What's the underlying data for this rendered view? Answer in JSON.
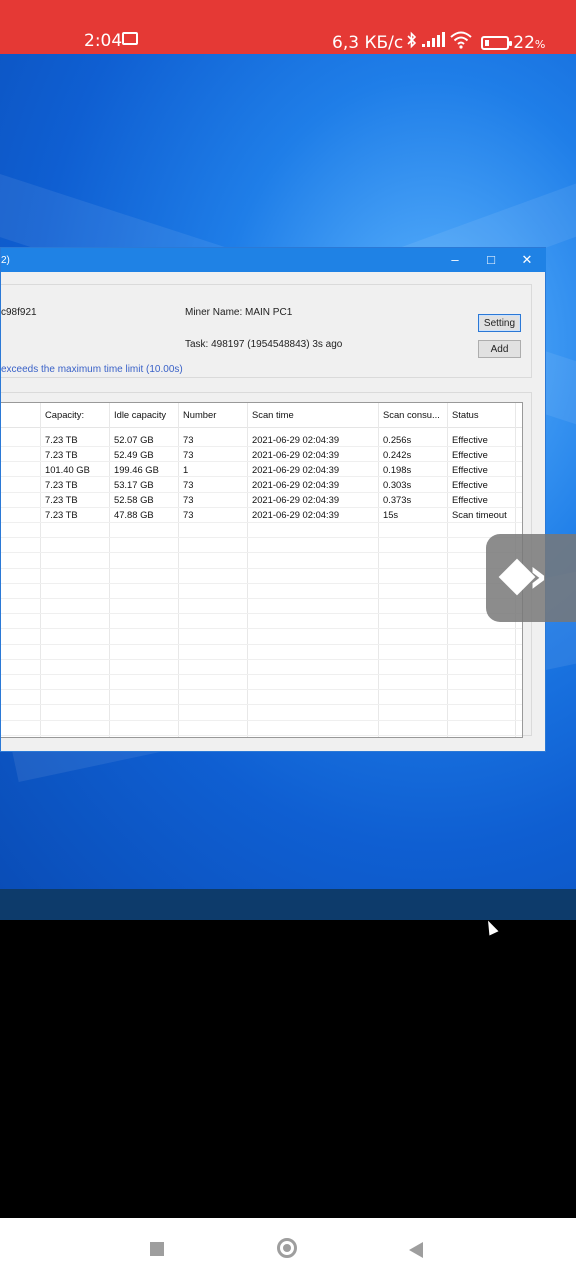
{
  "status_bar": {
    "time": "2:04",
    "speed": "6,3 КБ/с",
    "battery_percent": "22",
    "battery_unit": "%",
    "battery_level": 0.22,
    "background_color": "#e53935",
    "icons": [
      "screen-notification-icon",
      "bluetooth-icon",
      "signal-icon",
      "wifi-icon",
      "battery-icon"
    ]
  },
  "window": {
    "title_fragment": "2)",
    "id_fragment": "c98f921",
    "miner_name_label": "Miner Name:",
    "miner_name_value": "MAIN PC1",
    "task_label": "Task:",
    "task_text": "498197   (1954548843) 3s ago",
    "warning": "exceeds the maximum time limit (10.00s)",
    "setting_button": "Setting",
    "add_button": "Add",
    "accent_color": "#1f82e5"
  },
  "table": {
    "columns": [
      "Capacity:",
      "Idle capacity",
      "Number",
      "Scan time",
      "Scan consu...",
      "Status"
    ],
    "rows": [
      [
        "7.23 TB",
        "52.07 GB",
        "73",
        "2021-06-29 02:04:39",
        "0.256s",
        "Effective"
      ],
      [
        "7.23 TB",
        "52.49 GB",
        "73",
        "2021-06-29 02:04:39",
        "0.242s",
        "Effective"
      ],
      [
        "101.40 GB",
        "199.46 GB",
        "1",
        "2021-06-29 02:04:39",
        "0.198s",
        "Effective"
      ],
      [
        "7.23 TB",
        "53.17 GB",
        "73",
        "2021-06-29 02:04:39",
        "0.303s",
        "Effective"
      ],
      [
        "7.23 TB",
        "52.58 GB",
        "73",
        "2021-06-29 02:04:39",
        "0.373s",
        "Effective"
      ],
      [
        "7.23 TB",
        "47.88 GB",
        "73",
        "2021-06-29 02:04:39",
        "15s",
        "Scan timeout"
      ]
    ]
  },
  "nav_bar": {
    "icons": [
      "recents-square-icon",
      "home-circle-icon",
      "back-triangle-icon"
    ]
  }
}
